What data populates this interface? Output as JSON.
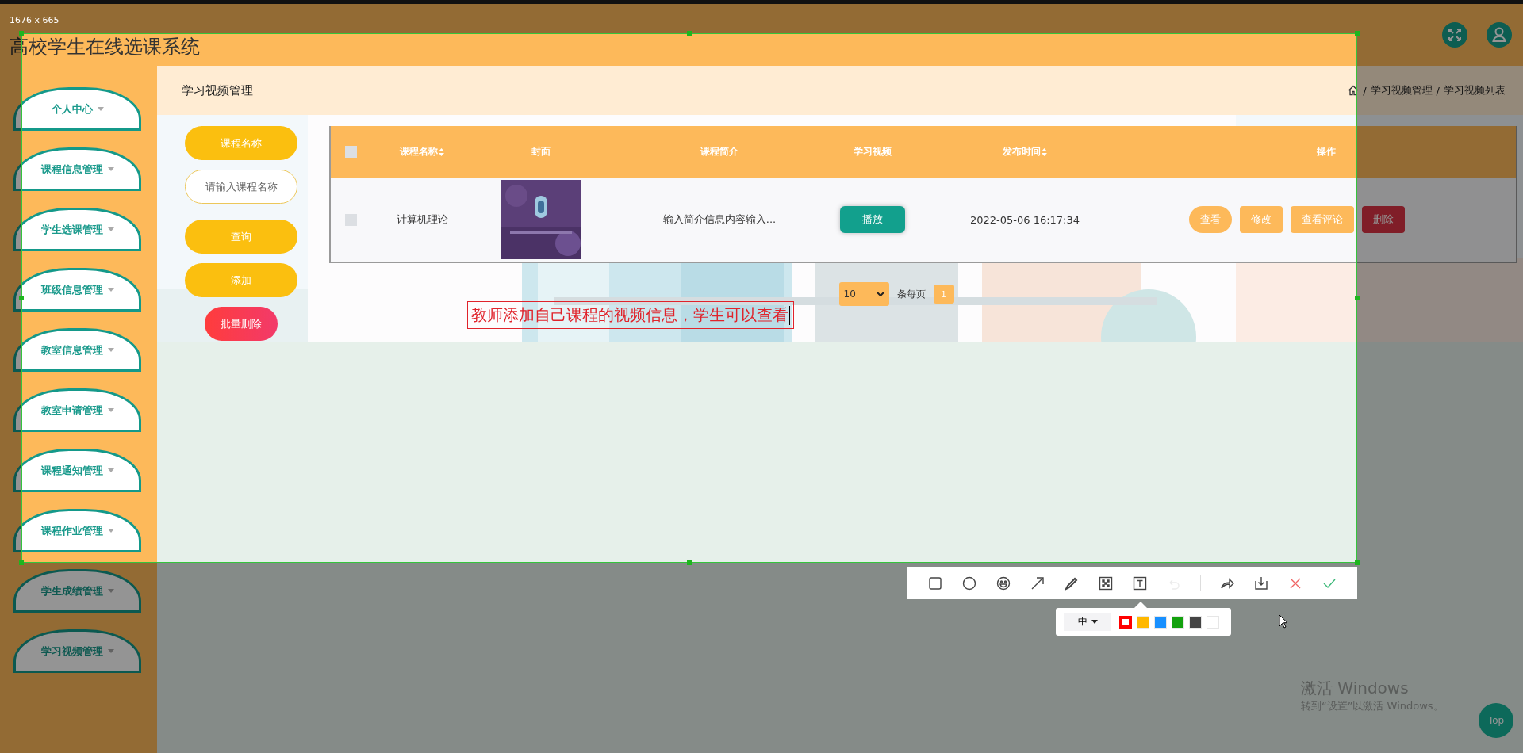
{
  "capture": {
    "size_label": "1676 x 665"
  },
  "app": {
    "title": "高校学生在线选课系统"
  },
  "sidebar": {
    "items": [
      {
        "label": "个人中心"
      },
      {
        "label": "课程信息管理"
      },
      {
        "label": "学生选课管理"
      },
      {
        "label": "班级信息管理"
      },
      {
        "label": "教室信息管理"
      },
      {
        "label": "教室申请管理"
      },
      {
        "label": "课程通知管理"
      },
      {
        "label": "课程作业管理"
      },
      {
        "label": "学生成绩管理"
      },
      {
        "label": "学习视频管理"
      }
    ]
  },
  "page": {
    "title": "学习视频管理",
    "breadcrumb": [
      "学习视频管理",
      "学习视频列表"
    ],
    "breadcrumb_separator": "/"
  },
  "search": {
    "label": "课程名称",
    "placeholder": "请输入课程名称",
    "buttons": [
      {
        "label": "查询",
        "kind": "primary"
      },
      {
        "label": "添加",
        "kind": "primary"
      },
      {
        "label": "批量删除",
        "kind": "danger"
      }
    ]
  },
  "table": {
    "select_all_checked": false,
    "columns": [
      {
        "label": "课程名称",
        "sortable": true
      },
      {
        "label": "封面",
        "sortable": false
      },
      {
        "label": "课程简介",
        "sortable": false
      },
      {
        "label": "学习视频",
        "sortable": false
      },
      {
        "label": "发布时间",
        "sortable": true
      },
      {
        "label": "操作",
        "sortable": false
      }
    ],
    "rows": [
      {
        "checked": false,
        "name": "计算机理论",
        "intro": "输入简介信息内容输入...",
        "video_button": "播放",
        "published": "2022-05-06 16:17:34",
        "actions": [
          {
            "label": "查看",
            "kind": "view"
          },
          {
            "label": "修改",
            "kind": "edit"
          },
          {
            "label": "查看评论",
            "kind": "comments"
          },
          {
            "label": "删除",
            "kind": "delete"
          }
        ]
      }
    ]
  },
  "pagination": {
    "page_size": "10",
    "page_size_label": "条每页",
    "pages": [
      {
        "label": "1",
        "selected": true
      }
    ]
  },
  "annotation": {
    "text": "教师添加自己课程的视频信息，学生可以查看"
  },
  "toolbar": {
    "tools": [
      {
        "kind": "rectangle",
        "disabled": false
      },
      {
        "kind": "ellipse",
        "disabled": false
      },
      {
        "kind": "emoji",
        "disabled": false
      },
      {
        "kind": "arrow",
        "disabled": false
      },
      {
        "kind": "pen",
        "disabled": false
      },
      {
        "kind": "mosaic",
        "disabled": false
      },
      {
        "kind": "text",
        "disabled": false
      },
      {
        "kind": "undo",
        "disabled": true
      },
      {
        "kind": "separator",
        "disabled": false
      },
      {
        "kind": "share",
        "disabled": false
      },
      {
        "kind": "save",
        "disabled": false
      },
      {
        "kind": "cancel",
        "disabled": false
      },
      {
        "kind": "confirm",
        "disabled": false
      }
    ]
  },
  "text_options": {
    "size": "中",
    "colors": [
      {
        "color": "#ff0000",
        "selected": true
      },
      {
        "color": "#ffb800",
        "selected": false
      },
      {
        "color": "#1890ff",
        "selected": false
      },
      {
        "color": "#13a10e",
        "selected": false
      },
      {
        "color": "#444444",
        "selected": false
      },
      {
        "color": "#ffffff",
        "selected": false
      }
    ]
  },
  "back_to_top": "Top",
  "os_notice": {
    "title": "激活 Windows",
    "subtitle": "转到“设置”以激活 Windows。"
  }
}
